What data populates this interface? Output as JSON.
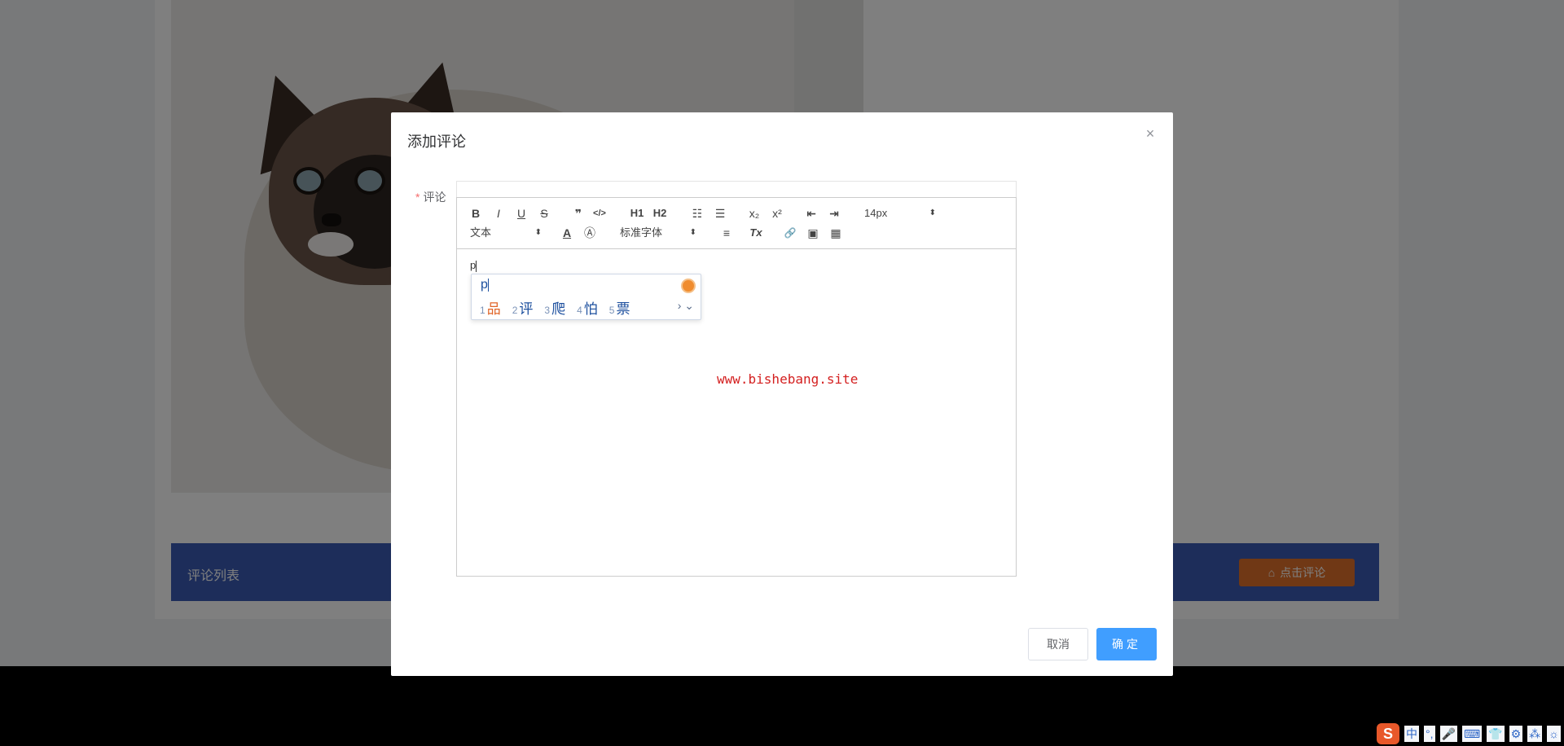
{
  "page": {
    "comments_title": "评论列表",
    "add_comment_button": "点击评论"
  },
  "modal": {
    "title": "添加评论",
    "close_icon": "×",
    "field_label": "评论",
    "required_mark": "*",
    "cancel_label": "取消",
    "ok_label": "确定"
  },
  "editor": {
    "toolbar": {
      "bold": "B",
      "italic": "I",
      "underline": "U",
      "strike": "S",
      "blockquote": "❞",
      "code_block": "</>",
      "h1": "H1",
      "h2": "H2",
      "ordered_list": "☷",
      "bullet_list": "☰",
      "subscript": "x₂",
      "superscript": "x²",
      "outdent": "⇤",
      "indent": "⇥",
      "size_value": "14px",
      "header_value": "文本",
      "color": "A",
      "background": "Ⓐ",
      "font_value": "标准字体",
      "align": "≡",
      "clean": "Tx",
      "link": "🔗",
      "image": "▣",
      "video": "▦"
    },
    "content_text": "p"
  },
  "ime": {
    "input": "p",
    "candidates": [
      {
        "num": "1",
        "text": "品"
      },
      {
        "num": "2",
        "text": "评"
      },
      {
        "num": "3",
        "text": "爬"
      },
      {
        "num": "4",
        "text": "怕"
      },
      {
        "num": "5",
        "text": "票"
      }
    ],
    "more": "› ⌄"
  },
  "watermark": "www.bishebang.site",
  "tray": {
    "logo": "S",
    "items": [
      "中",
      "°,",
      "🎤",
      "⌨",
      "👕",
      "⚙",
      "⁂",
      "☼"
    ]
  },
  "colors": {
    "primary": "#409eff",
    "comments_bar": "#3a5bb5",
    "accent_orange": "#e0702a",
    "watermark": "#d42020"
  }
}
